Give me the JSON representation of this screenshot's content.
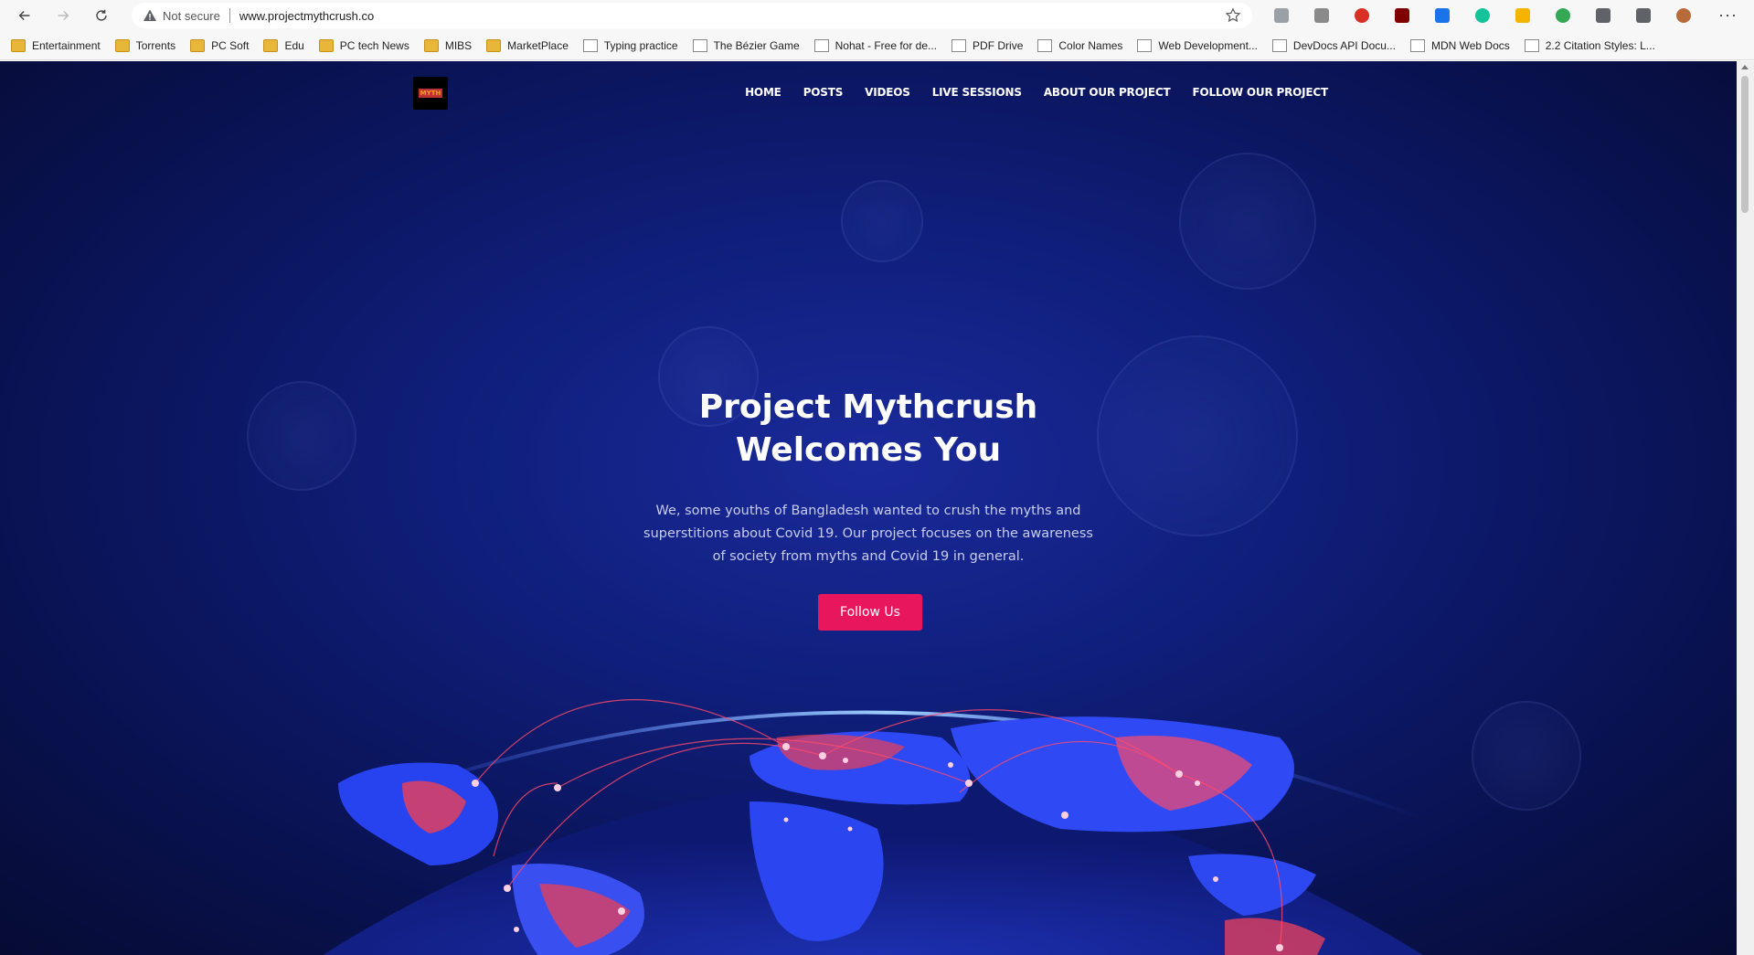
{
  "browser": {
    "security_label": "Not secure",
    "url": "www.projectmythcrush.co",
    "extensions": [
      {
        "name": "translate-ext-icon",
        "color": "#9aa0a6"
      },
      {
        "name": "bug-ext-icon",
        "color": "#8a8a8a"
      },
      {
        "name": "red-circle-ext-icon",
        "color": "#d93025"
      },
      {
        "name": "ublock-ext-icon",
        "color": "#800000"
      },
      {
        "name": "s-ext-icon",
        "color": "#1a73e8"
      },
      {
        "name": "grammarly-ext-icon",
        "color": "#15c39a"
      },
      {
        "name": "drive-ext-icon",
        "color": "#f4b400"
      },
      {
        "name": "globe-ext-icon",
        "color": "#34a853"
      },
      {
        "name": "puzzle-ext-icon",
        "color": "#5f6368"
      },
      {
        "name": "collections-ext-icon",
        "color": "#5f6368"
      },
      {
        "name": "profile-avatar-icon",
        "color": "#b86b3a"
      }
    ]
  },
  "bookmarks": [
    {
      "label": "Entertainment",
      "icon": "folder-icon"
    },
    {
      "label": "Torrents",
      "icon": "folder-icon"
    },
    {
      "label": "PC Soft",
      "icon": "folder-icon"
    },
    {
      "label": "Edu",
      "icon": "folder-icon"
    },
    {
      "label": "PC tech News",
      "icon": "folder-icon"
    },
    {
      "label": "MIBS",
      "icon": "folder-icon"
    },
    {
      "label": "MarketPlace",
      "icon": "folder-icon"
    },
    {
      "label": "Typing practice",
      "icon": "page-icon"
    },
    {
      "label": "The Bézier Game",
      "icon": "page-icon"
    },
    {
      "label": "Nohat - Free for de...",
      "icon": "page-icon"
    },
    {
      "label": "PDF Drive",
      "icon": "page-icon"
    },
    {
      "label": "Color Names",
      "icon": "page-icon"
    },
    {
      "label": "Web Development...",
      "icon": "page-icon"
    },
    {
      "label": "DevDocs API Docu...",
      "icon": "page-icon"
    },
    {
      "label": "MDN Web Docs",
      "icon": "page-icon"
    },
    {
      "label": "2.2 Citation Styles: L...",
      "icon": "page-icon"
    }
  ],
  "site": {
    "nav": [
      "HOME",
      "POSTS",
      "VIDEOS",
      "LIVE SESSIONS",
      "ABOUT OUR PROJECT",
      "FOLLOW OUR PROJECT"
    ],
    "hero_title": "Project Mythcrush Welcomes You",
    "hero_text": "We, some youths of Bangladesh wanted to crush the myths and superstitions about Covid 19. Our project focuses on the awareness of society from myths and Covid 19 in general.",
    "cta_label": "Follow Us"
  },
  "colors": {
    "cta": "#e8175d",
    "background": "#0f1e7a"
  }
}
